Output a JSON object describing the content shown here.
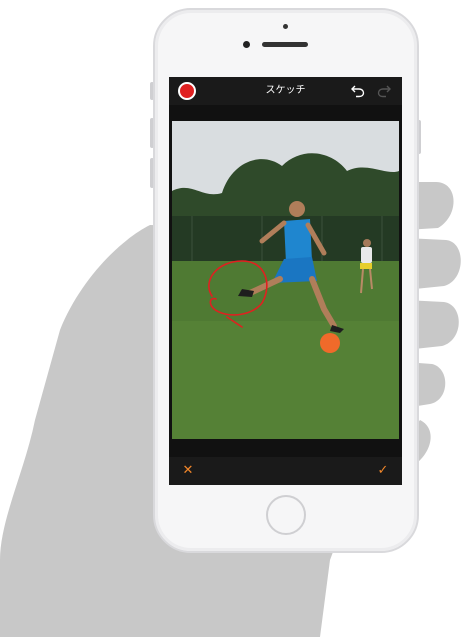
{
  "sketch_screen": {
    "title": "スケッチ",
    "icons": {
      "record": "record-icon",
      "undo": "undo-icon",
      "redo": "redo-icon",
      "cancel": "close-icon",
      "confirm": "checkmark-icon"
    },
    "cancel_glyph": "✕",
    "confirm_glyph": "✓"
  },
  "colors": {
    "accent": "#f0862a",
    "record": "#e02020",
    "annotation": "#e02020",
    "toolbar": "#1a1a1a"
  }
}
